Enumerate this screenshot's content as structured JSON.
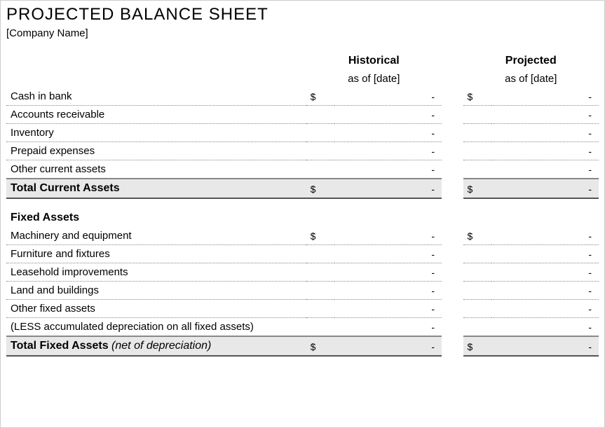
{
  "title": "PROJECTED BALANCE SHEET",
  "company": "[Company Name]",
  "columns": {
    "historical": {
      "label": "Historical",
      "asof": "as of [date]"
    },
    "projected": {
      "label": "Projected",
      "asof": "as of [date]"
    }
  },
  "currency_symbol": "$",
  "dash": "-",
  "current_assets": {
    "rows": [
      {
        "label": "Cash in bank",
        "hist": "-",
        "proj": "-",
        "show_sym": true
      },
      {
        "label": "Accounts receivable",
        "hist": "-",
        "proj": "-",
        "show_sym": false
      },
      {
        "label": "Inventory",
        "hist": "-",
        "proj": "-",
        "show_sym": false
      },
      {
        "label": "Prepaid expenses",
        "hist": "-",
        "proj": "-",
        "show_sym": false
      },
      {
        "label": "Other current assets",
        "hist": "-",
        "proj": "-",
        "show_sym": false
      }
    ],
    "total": {
      "label": "Total Current Assets",
      "hist": "-",
      "proj": "-"
    }
  },
  "fixed_assets": {
    "heading": "Fixed Assets",
    "rows": [
      {
        "label": "Machinery and equipment",
        "hist": "-",
        "proj": "-",
        "show_sym": true
      },
      {
        "label": "Furniture and fixtures",
        "hist": "-",
        "proj": "-",
        "show_sym": false
      },
      {
        "label": "Leasehold improvements",
        "hist": "-",
        "proj": "-",
        "show_sym": false
      },
      {
        "label": "Land and buildings",
        "hist": "-",
        "proj": "-",
        "show_sym": false
      },
      {
        "label": "Other fixed assets",
        "hist": "-",
        "proj": "-",
        "show_sym": false
      },
      {
        "label": "(LESS accumulated depreciation on all fixed assets)",
        "hist": "-",
        "proj": "-",
        "show_sym": false
      }
    ],
    "total": {
      "label_bold": "Total Fixed Assets ",
      "label_italic": "(net of depreciation)",
      "hist": "-",
      "proj": "-"
    }
  }
}
